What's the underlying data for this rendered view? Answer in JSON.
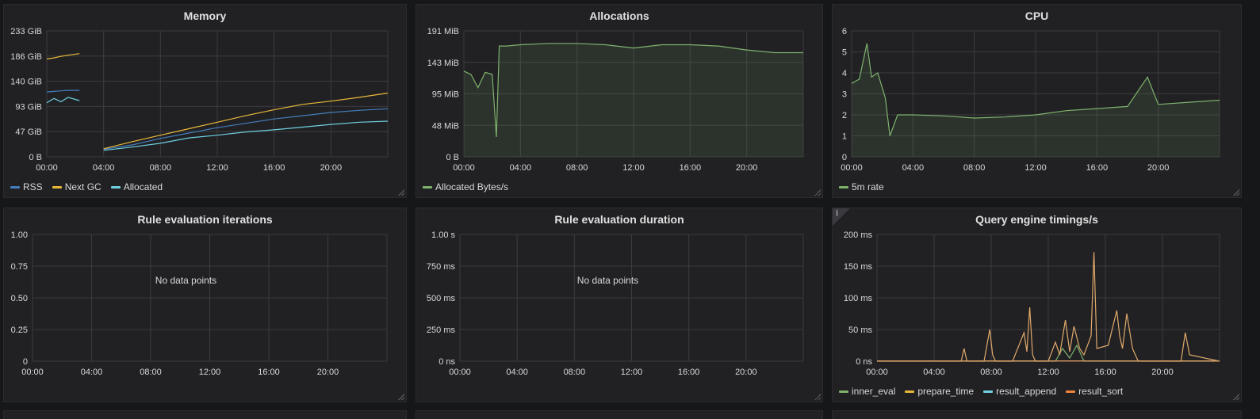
{
  "colors": {
    "panel_bg": "#212124",
    "grid": "#3c3c40",
    "axis_text": "#d8d9da",
    "rss": "#447ebc",
    "next_gc": "#eab839",
    "allocated": "#6ed0e0",
    "green": "#7eb26d",
    "orange_sum": "#e0a96a",
    "result_sort": "#ef843c"
  },
  "panels": [
    {
      "id": "memory",
      "title": "Memory",
      "legend": [
        {
          "label": "RSS",
          "color": "#447ebc"
        },
        {
          "label": "Next GC",
          "color": "#eab839"
        },
        {
          "label": "Allocated",
          "color": "#6ed0e0"
        }
      ]
    },
    {
      "id": "allocations",
      "title": "Allocations",
      "legend": [
        {
          "label": "Allocated Bytes/s",
          "color": "#7eb26d"
        }
      ]
    },
    {
      "id": "cpu",
      "title": "CPU",
      "legend": [
        {
          "label": "5m rate",
          "color": "#7eb26d"
        }
      ]
    },
    {
      "id": "rule_iter",
      "title": "Rule evaluation iterations",
      "legend": [],
      "no_data": "No data points"
    },
    {
      "id": "rule_dur",
      "title": "Rule evaluation duration",
      "legend": [],
      "no_data": "No data points"
    },
    {
      "id": "query",
      "title": "Query engine timings/s",
      "info_icon": "i",
      "legend": [
        {
          "label": "inner_eval",
          "color": "#7eb26d"
        },
        {
          "label": "prepare_time",
          "color": "#eab839"
        },
        {
          "label": "result_append",
          "color": "#6ed0e0"
        },
        {
          "label": "result_sort",
          "color": "#ef843c"
        }
      ]
    }
  ],
  "chart_data": [
    {
      "type": "line",
      "title": "Memory",
      "x_ticks": [
        "00:00",
        "04:00",
        "08:00",
        "12:00",
        "16:00",
        "20:00"
      ],
      "x_range_hours": [
        0,
        24
      ],
      "y_ticks": [
        "0 B",
        "47 GiB",
        "93 GiB",
        "140 GiB",
        "186 GiB",
        "233 GiB"
      ],
      "y_range_gib": [
        0,
        233
      ],
      "series": [
        {
          "name": "RSS",
          "x": [
            0,
            0.5,
            1,
            1.5,
            2.3,
            2.5,
            4,
            6,
            8,
            10,
            12,
            14,
            16,
            18,
            20,
            22,
            24
          ],
          "y": [
            120,
            121,
            122,
            123,
            123,
            null,
            14,
            22,
            34,
            44,
            54,
            62,
            70,
            76,
            82,
            86,
            89
          ]
        },
        {
          "name": "Next GC",
          "x": [
            0,
            0.5,
            1,
            1.5,
            2.3,
            2.5,
            4,
            6,
            8,
            10,
            12,
            14,
            16,
            18,
            20,
            22,
            24
          ],
          "y": [
            181,
            183,
            186,
            188,
            191,
            null,
            15,
            28,
            40,
            52,
            64,
            76,
            87,
            97,
            103,
            110,
            118
          ]
        },
        {
          "name": "Allocated",
          "x": [
            0,
            0.5,
            1,
            1.5,
            2.3,
            2.5,
            4,
            6,
            8,
            10,
            12,
            14,
            16,
            18,
            20,
            22,
            24
          ],
          "y": [
            100,
            108,
            102,
            110,
            104,
            null,
            12,
            18,
            25,
            35,
            40,
            46,
            50,
            55,
            60,
            64,
            66
          ]
        }
      ]
    },
    {
      "type": "area",
      "title": "Allocations",
      "x_ticks": [
        "00:00",
        "04:00",
        "08:00",
        "12:00",
        "16:00",
        "20:00"
      ],
      "x_range_hours": [
        0,
        24
      ],
      "y_ticks": [
        "0 B",
        "48 MiB",
        "95 MiB",
        "143 MiB",
        "191 MiB"
      ],
      "y_range_mib": [
        0,
        191
      ],
      "series": [
        {
          "name": "Allocated Bytes/s",
          "x": [
            0,
            0.5,
            1,
            1.5,
            2,
            2.3,
            2.5,
            3,
            4,
            6,
            8,
            10,
            12,
            14,
            16,
            18,
            20,
            22,
            24
          ],
          "y": [
            130,
            125,
            105,
            128,
            125,
            30,
            168,
            168,
            170,
            172,
            172,
            170,
            165,
            170,
            170,
            168,
            162,
            158,
            158
          ]
        }
      ]
    },
    {
      "type": "area",
      "title": "CPU",
      "x_ticks": [
        "00:00",
        "04:00",
        "08:00",
        "12:00",
        "16:00",
        "20:00"
      ],
      "x_range_hours": [
        0,
        24
      ],
      "y_ticks": [
        "0",
        "1",
        "2",
        "3",
        "4",
        "5",
        "6"
      ],
      "y_range": [
        0,
        6
      ],
      "series": [
        {
          "name": "5m rate",
          "x": [
            0,
            0.5,
            1,
            1.3,
            1.7,
            2.2,
            2.5,
            3,
            4,
            6,
            8,
            10,
            12,
            14,
            16,
            18,
            19.3,
            20,
            22,
            24
          ],
          "y": [
            3.5,
            3.7,
            5.4,
            3.8,
            4.0,
            2.8,
            1.0,
            2.0,
            2.0,
            1.95,
            1.85,
            1.9,
            2.0,
            2.2,
            2.3,
            2.4,
            3.8,
            2.5,
            2.6,
            2.7
          ]
        }
      ]
    },
    {
      "type": "line",
      "title": "Rule evaluation iterations",
      "x_ticks": [
        "00:00",
        "04:00",
        "08:00",
        "12:00",
        "16:00",
        "20:00"
      ],
      "y_ticks": [
        "0",
        "0.25",
        "0.50",
        "0.75",
        "1.00"
      ],
      "y_range": [
        0,
        1
      ],
      "series": []
    },
    {
      "type": "line",
      "title": "Rule evaluation duration",
      "x_ticks": [
        "00:00",
        "04:00",
        "08:00",
        "12:00",
        "16:00",
        "20:00"
      ],
      "y_ticks": [
        "0 ns",
        "250 ms",
        "500 ms",
        "750 ms",
        "1.00 s"
      ],
      "y_range_ms": [
        0,
        1000
      ],
      "series": []
    },
    {
      "type": "line",
      "title": "Query engine timings/s",
      "x_ticks": [
        "00:00",
        "04:00",
        "08:00",
        "12:00",
        "16:00",
        "20:00"
      ],
      "x_range_hours": [
        0,
        24
      ],
      "y_ticks": [
        "0 ns",
        "50 ms",
        "100 ms",
        "150 ms",
        "200 ms"
      ],
      "y_range_ms": [
        0,
        200
      ],
      "series": [
        {
          "name": "inner_eval",
          "x": [
            0,
            12.5,
            13.0,
            13.5,
            14.0,
            14.5,
            24
          ],
          "y": [
            0,
            0,
            20,
            5,
            25,
            0,
            0
          ]
        },
        {
          "name": "prepare_time",
          "x": [
            0,
            5.9,
            6.1,
            6.3,
            7.5,
            7.7,
            7.9,
            8.1,
            8.3,
            9.5,
            10.3,
            10.5,
            10.7,
            10.9,
            11.1,
            11.3,
            12.0,
            12.5,
            12.8,
            13.2,
            13.5,
            13.8,
            14.2,
            14.5,
            15.0,
            15.2,
            15.4,
            16.2,
            16.8,
            17.0,
            17.2,
            17.5,
            17.9,
            18.3,
            21.3,
            21.6,
            21.9,
            24
          ],
          "y": [
            0,
            0,
            20,
            0,
            0,
            25,
            50,
            10,
            0,
            0,
            45,
            15,
            85,
            10,
            0,
            0,
            0,
            30,
            10,
            65,
            15,
            55,
            20,
            10,
            40,
            172,
            20,
            25,
            80,
            40,
            20,
            75,
            20,
            0,
            0,
            45,
            10,
            0
          ]
        },
        {
          "name": "result_append",
          "x": [
            0,
            24
          ],
          "y": [
            0.5,
            0.5
          ]
        },
        {
          "name": "result_sort",
          "x": [
            0,
            24
          ],
          "y": [
            0.2,
            0.2
          ]
        }
      ]
    }
  ]
}
